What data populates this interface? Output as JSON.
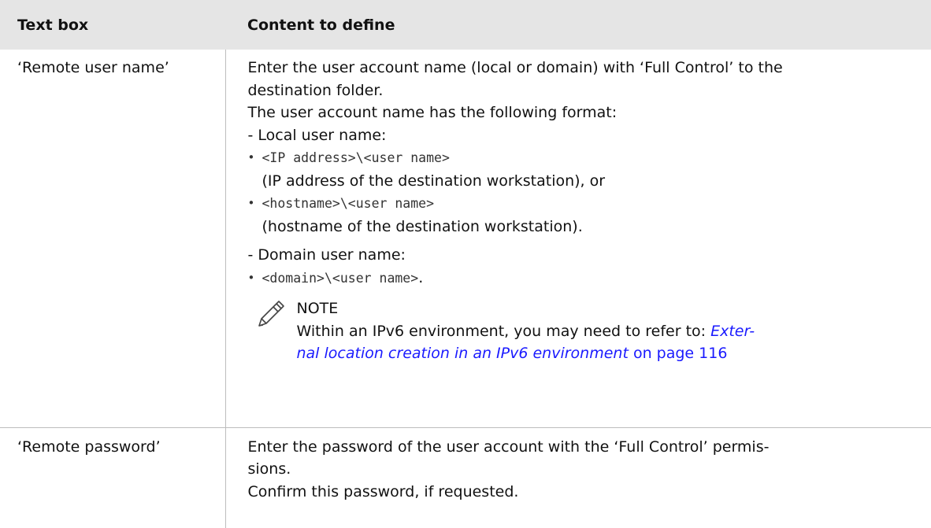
{
  "header": {
    "col1": "Text box",
    "col2": "Content to define"
  },
  "rows": [
    {
      "key": "‘Remote user name’",
      "lines": [
        "Enter the user account name (local or domain) with ‘Full Control’ to the",
        "destination folder.",
        "The user account name has the following format:",
        "- Local user name:"
      ],
      "bullet1_code": "<IP address>\\<user name>",
      "bullet1_sub": "(IP address of the destination workstation), or",
      "bullet2_code": "<hostname>\\<user name>",
      "bullet2_sub": "(hostname of the destination workstation).",
      "domain_line": "- Domain user name:",
      "bullet3_code": "<domain>\\<user name>",
      "bullet3_suffix": ".",
      "note_icon": "pencil-icon",
      "note_title": "NOTE",
      "note_text": "Within an IPv6 environment, you may need to refer to: ",
      "note_link_line1": "Exter-",
      "note_link_line2": "nal location creation in an IPv6 environment",
      "note_page_ref": " on page 116"
    },
    {
      "key": "‘Remote password’",
      "lines": [
        "Enter the password of the user account with the ‘Full Control’ permis-",
        "sions.",
        "Confirm this password, if requested."
      ]
    }
  ]
}
